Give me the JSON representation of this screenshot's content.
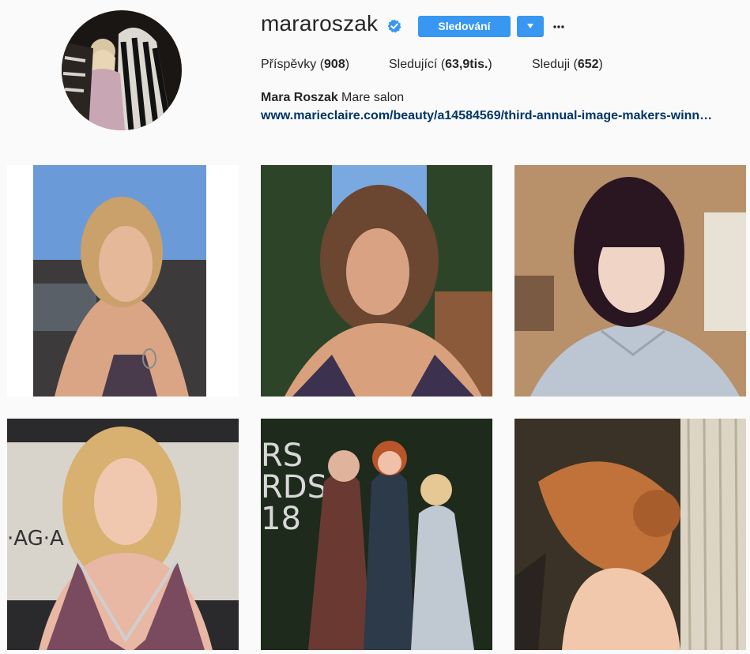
{
  "profile": {
    "username": "mararoszak",
    "verified": true,
    "follow_label": "Sledování",
    "dropdown_icon": "triangle-down-icon",
    "options_label": "···"
  },
  "stats": {
    "posts_label": "Příspěvky",
    "posts_value": "908",
    "followers_label": "Sledující",
    "followers_value": "63,9tis.",
    "following_label": "Sleduji",
    "following_value": "652"
  },
  "bio": {
    "full_name": "Mara Roszak",
    "text": "Mare salon",
    "link": "www.marieclaire.com/beauty/a14584569/third-annual-image-makers-winn…"
  },
  "colors": {
    "accent": "#3897f0",
    "link": "#003569",
    "background": "#fafafa"
  },
  "posts": [
    {
      "subject": "blonde bob selfie, blue sky"
    },
    {
      "subject": "curly brunette, garden"
    },
    {
      "subject": "dark bangs, gray shirt"
    },
    {
      "subject": "blonde waves, red carpet"
    },
    {
      "subject": "three women, event wall"
    },
    {
      "subject": "low bun updo backstage"
    }
  ]
}
